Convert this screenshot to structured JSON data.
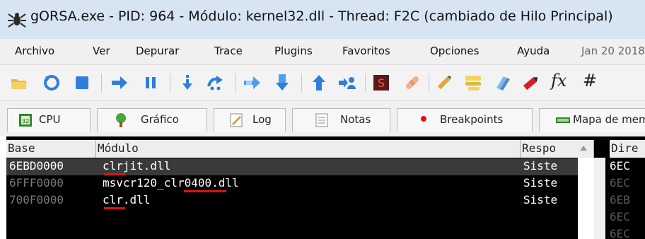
{
  "window": {
    "title": "gORSA.exe - PID: 964 - Módulo: kernel32.dll - Thread: F2C (cambiado de Hilo Principal)"
  },
  "menu": {
    "items": [
      "Archivo",
      "Ver",
      "Depurar",
      "Trace",
      "Plugins",
      "Favoritos",
      "Opciones",
      "Ayuda"
    ],
    "date": "Jan 20 2018"
  },
  "toolbar": {
    "icons": [
      "open-folder-icon",
      "restart-icon",
      "stop-icon",
      "run-icon",
      "pause-icon",
      "step-into-icon",
      "step-over-icon",
      "trace-into-icon",
      "trace-over-icon",
      "execute-till-return-icon",
      "run-to-user-code-icon",
      "scylla-icon",
      "patch-icon",
      "comment-icon",
      "label-icon",
      "bookmark-icon",
      "function-icon",
      "hash-icon"
    ],
    "fx_label": "fx",
    "hash_label": "#"
  },
  "tabs": [
    {
      "label": "CPU",
      "icon": "cpu-icon"
    },
    {
      "label": "Gráfico",
      "icon": "graph-icon"
    },
    {
      "label": "Log",
      "icon": "log-icon"
    },
    {
      "label": "Notas",
      "icon": "notes-icon"
    },
    {
      "label": "Breakpoints",
      "icon": "breakpoint-dot-icon"
    },
    {
      "label": "Mapa de memoria",
      "icon": "memory-map-icon"
    }
  ],
  "table": {
    "columns": [
      "Base",
      "Módulo",
      "Respo",
      "Dire"
    ],
    "rows": [
      {
        "base": "6EBD0000",
        "module": "clrjit.dll",
        "party": "Siste",
        "addr": "6EC"
      },
      {
        "base": "6FFF0000",
        "module": "msvcr120_clr0400.dll",
        "party": "Siste",
        "addr": "6EC"
      },
      {
        "base": "700F0000",
        "module": "clr.dll",
        "party": "Siste",
        "addr": "6EB"
      }
    ],
    "extra_right_cells": [
      "6EC",
      "6EC"
    ]
  },
  "colors": {
    "title_bar": "#d7e4f2",
    "table_bg": "#000000",
    "selected_row": "#3a3a3a",
    "text_light": "#ffffff",
    "text_dim": "#7a7a7a",
    "underline": "#e01010"
  }
}
